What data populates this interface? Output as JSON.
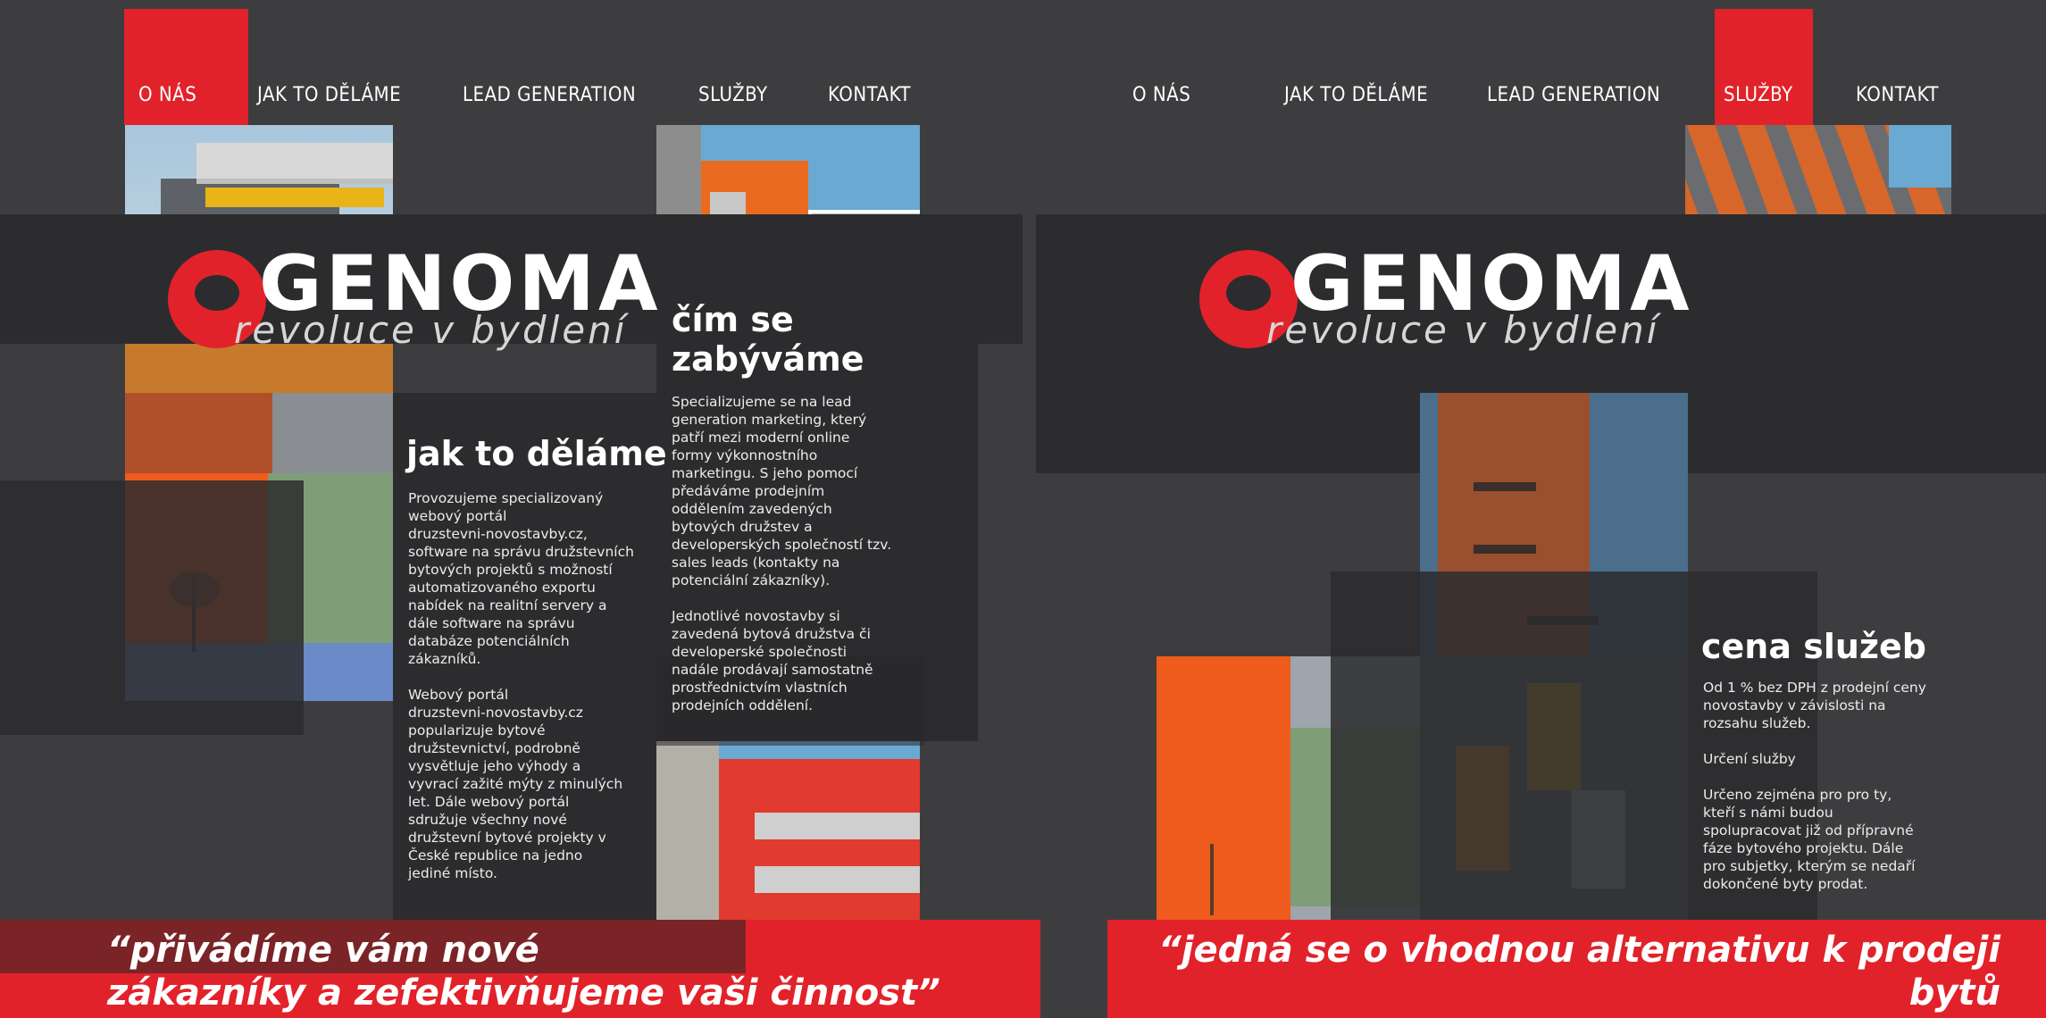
{
  "left_page": {
    "nav": {
      "items": [
        "O NÁS",
        "JAK TO DĚLÁME",
        "LEAD GENERATION",
        "SLUŽBY",
        "KONTAKT"
      ],
      "active_index": 0
    },
    "logo": {
      "word": "GENOMA",
      "tagline": "revoluce v bydlení"
    },
    "section1": {
      "heading": "jak to děláme",
      "body": "Provozujeme specializovaný\nwebový portál\ndruzstevni-novostavby.cz,\nsoftware na správu družstevních\nbytových projektů s možností\nautomatizovaného exportu\nnabídek na realitní servery a\ndále software na správu\ndatabáze potenciálních\nzákazníků.\n\nWebový portál\ndruzstevni-novostavby.cz\npopularizuje bytové\ndružstevnictví, podrobně\nvysvětluje jeho výhody a\nvyvrací zažité mýty z minulých\nlet. Dále webový portál\nsdružuje všechny nové\ndružstevní bytové projekty v\nČeské republice na jedno\njediné místo."
    },
    "section2": {
      "heading": "čím se\nzabýváme",
      "body": "Specializujeme se na lead\ngeneration marketing, který\npatří mezi moderní online\nformy výkonnostního\nmarketingu. S jeho pomocí\npředáváme prodejním\noddělením zavedených\nbytových družstev a\ndeveloperských společností tzv.\nsales leads (kontakty na\npotenciální zákazníky).\n\nJednotlivé novostavby si\nzavedená bytová družstva či\ndeveloperské společnosti\nnadále prodávají samostatně\nprostřednictvím vlastních\nprodejních oddělení."
    },
    "quote": "“přivádíme vám nové\nzákazníky a zefektivňujeme vaši činnost”"
  },
  "right_page": {
    "nav": {
      "items": [
        "O NÁS",
        "JAK TO DĚLÁME",
        "LEAD GENERATION",
        "SLUŽBY",
        "KONTAKT"
      ],
      "active_index": 3
    },
    "logo": {
      "word": "GENOMA",
      "tagline": "revoluce v bydlení"
    },
    "section": {
      "heading": "cena služeb",
      "body": "Od 1 % bez DPH z prodejní ceny\nnovostavby v závislosti na\nrozsahu služeb.\n\nUrčení služby\n\nUrčeno zejména pro pro ty,\nkteří s námi budou\nspolupracovat již od přípravné\nfáze bytového projektu. Dále\npro subjetky, kterým se nedaří\ndokončené byty prodat."
    },
    "quote": "“jedná se o vhodnou alternativu k prodeji bytů\nskrze drahé realitní kanceláře”"
  },
  "colors": {
    "accent_red": "#e2222a",
    "background": "#3d3d3f",
    "band": "#2c2c2e"
  }
}
